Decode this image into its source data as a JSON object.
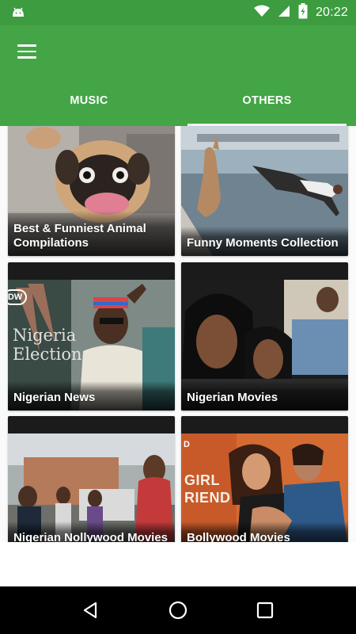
{
  "status_bar": {
    "time": "20:22",
    "icons": [
      "android-icon",
      "wifi-icon",
      "signal-icon",
      "battery-charging-icon"
    ]
  },
  "app_bar": {
    "menu_icon": "hamburger-menu-icon",
    "background": "#43a545",
    "tabs": [
      {
        "label": "MUSIC",
        "selected": false
      },
      {
        "label": "OTHERS",
        "selected": true
      }
    ]
  },
  "cards": [
    {
      "title": "Best & Funniest Animal Compilations",
      "image": "pug-image"
    },
    {
      "title": "Funny Moments Collection",
      "image": "kangaroo-image"
    },
    {
      "title": "Nigerian News",
      "image": "nigeria-election-image",
      "image_text": "Nigeria Election",
      "image_logo": "DW"
    },
    {
      "title": "Nigerian Movies",
      "image": "nigerian-actresses-image"
    },
    {
      "title": "Nigerian Nollywood Movies",
      "image": "nollywood-image"
    },
    {
      "title": "Bollywood Movies",
      "image": "bollywood-image",
      "image_text": "GIRL RIEND",
      "image_text_top": "D"
    }
  ],
  "nav_bar": {
    "back_icon": "back-triangle-icon",
    "home_icon": "home-circle-icon",
    "recents_icon": "recents-square-icon"
  }
}
